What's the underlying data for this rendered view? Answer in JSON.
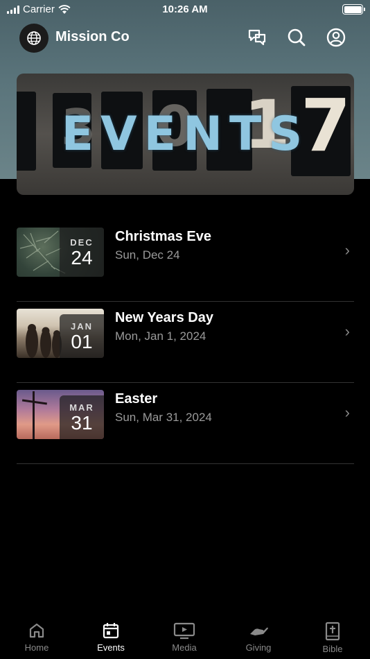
{
  "status_bar": {
    "carrier": "Carrier",
    "time": "10:26 AM"
  },
  "header": {
    "title": "Mission Co",
    "icons": [
      "globe-icon",
      "chat-icon",
      "search-icon",
      "profile-icon"
    ]
  },
  "banner": {
    "title": "EVENTS"
  },
  "events": [
    {
      "title": "Christmas Eve",
      "date": "Sun, Dec 24",
      "month": "DEC",
      "day": "24"
    },
    {
      "title": "New Years Day",
      "date": "Mon, Jan 1, 2024",
      "month": "JAN",
      "day": "01"
    },
    {
      "title": "Easter",
      "date": "Sun, Mar 31, 2024",
      "month": "MAR",
      "day": "31"
    }
  ],
  "tabs": [
    {
      "label": "Home",
      "icon": "home-icon"
    },
    {
      "label": "Events",
      "icon": "calendar-icon",
      "active": true
    },
    {
      "label": "Media",
      "icon": "tv-icon"
    },
    {
      "label": "Giving",
      "icon": "giving-hand-icon"
    },
    {
      "label": "Bible",
      "icon": "bible-icon"
    }
  ],
  "colors": {
    "header_bg": "#5a747b",
    "banner_text": "#8fc6e0",
    "active_tab": "#ffffff",
    "inactive_tab": "#8a8a8a"
  }
}
